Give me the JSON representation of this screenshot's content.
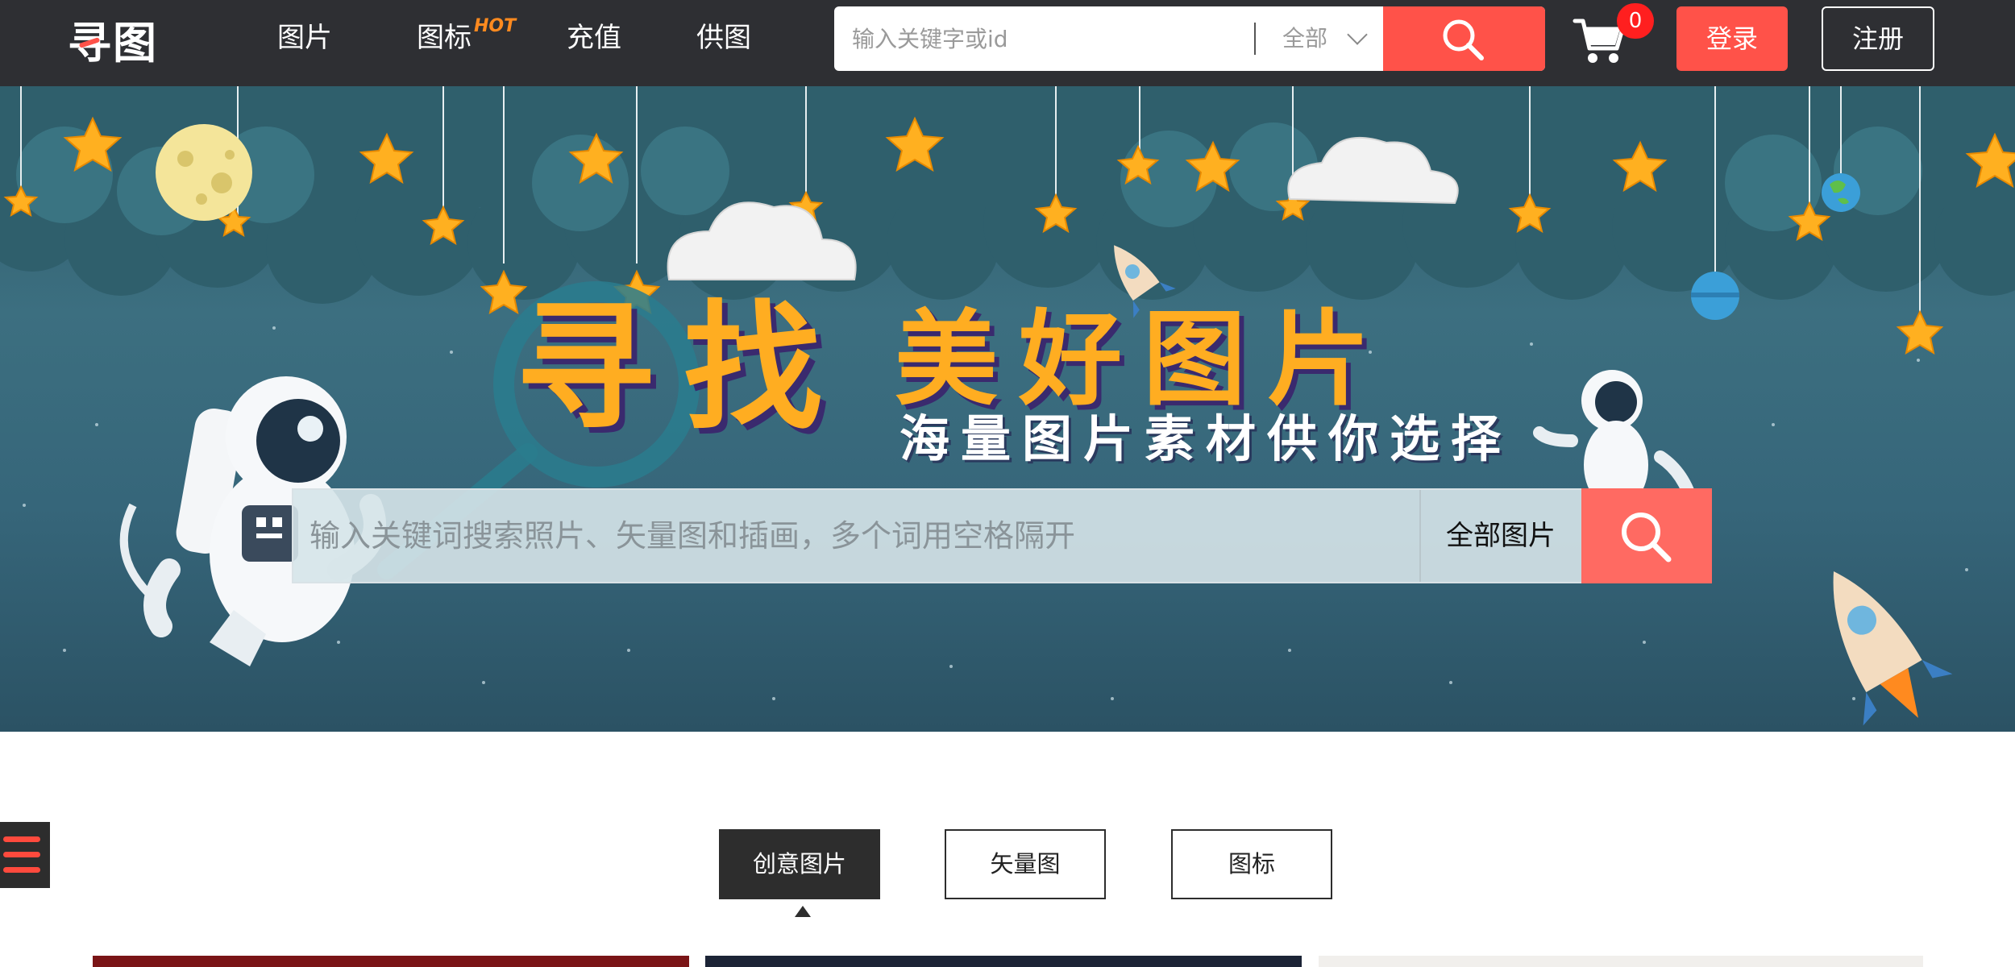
{
  "header": {
    "logo_text": "寻图",
    "nav": [
      {
        "label": "图片"
      },
      {
        "label": "图标",
        "badge": "HOT"
      },
      {
        "label": "充值"
      },
      {
        "label": "供图"
      }
    ],
    "search": {
      "placeholder": "输入关键字或id",
      "scope": "全部",
      "button_icon": "search-icon"
    },
    "cart": {
      "icon": "cart-icon",
      "count": "0"
    },
    "login_label": "登录",
    "register_label": "注册"
  },
  "hero": {
    "title_part1": "寻找",
    "title_part2": "美好图片",
    "subtitle": "海量图片素材供你选择",
    "search": {
      "placeholder": "输入关键词搜索照片、矢量图和插画，多个词用空格隔开",
      "scope": "全部图片",
      "button_icon": "search-icon"
    }
  },
  "content": {
    "menu_icon": "hamburger-icon",
    "tabs": [
      {
        "label": "创意图片",
        "active": true
      },
      {
        "label": "矢量图",
        "active": false
      },
      {
        "label": "图标",
        "active": false
      }
    ]
  },
  "colors": {
    "topbar_bg": "#2e2f33",
    "accent": "#ff5249",
    "hot_badge": "#ff8a1f",
    "hero_title": "#ffad21",
    "tab_active_bg": "#2d2d2d"
  }
}
